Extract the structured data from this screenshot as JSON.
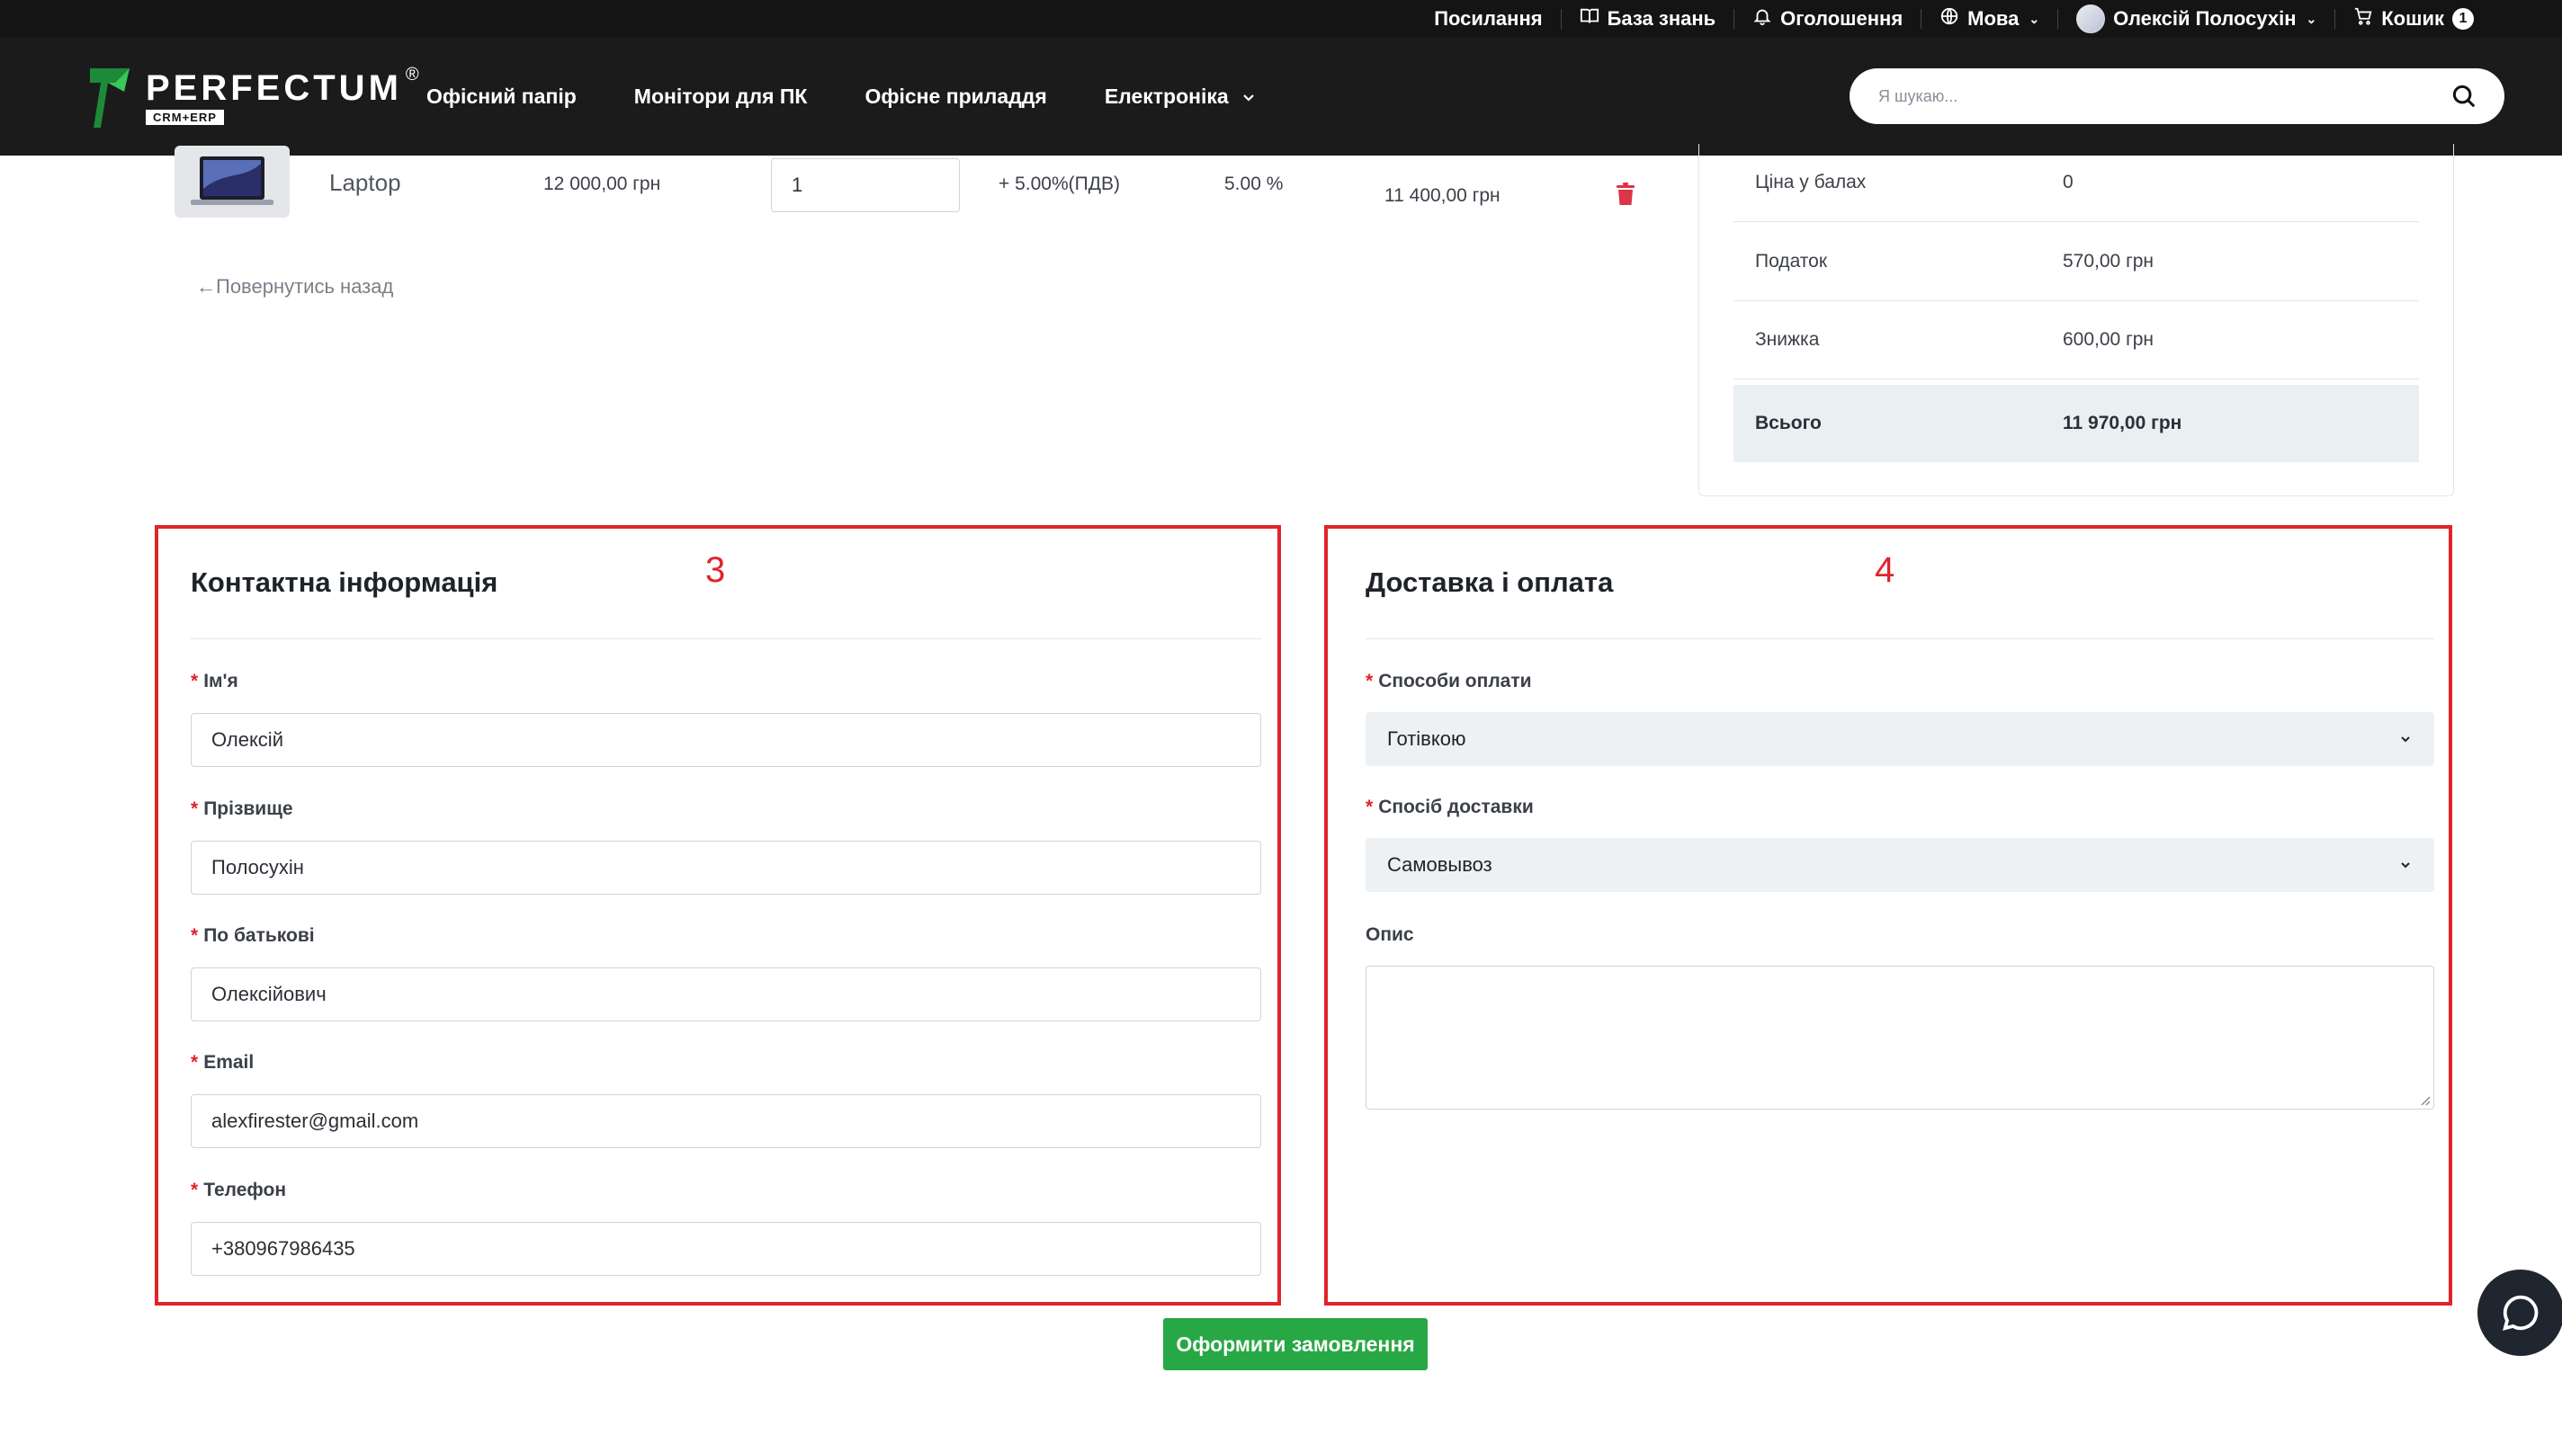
{
  "topbar": {
    "links": "Посилання",
    "knowledge_base": "База знань",
    "announcements": "Оголошення",
    "language": "Мова",
    "user_name": "Олексій Полосухін",
    "cart_label": "Кошик",
    "cart_count": "1"
  },
  "nav": {
    "brand": "PERFECTUM",
    "brand_sub": "CRM+ERP",
    "brand_reg": "®",
    "items": [
      "Офісний папір",
      "Монітори для ПК",
      "Офісне приладдя",
      "Електроніка"
    ],
    "search_placeholder": "Я шукаю..."
  },
  "cart_item": {
    "name": "Laptop",
    "price": "12 000,00 грн",
    "quantity": "1",
    "tax": "+ 5.00%(ПДВ)",
    "discount": "5.00 %",
    "total": "11 400,00 грн"
  },
  "back_link": "Повернутись назад",
  "summary": {
    "rows": [
      {
        "label": "Ціна у балах",
        "value": "0"
      },
      {
        "label": "Податок",
        "value": "570,00 грн"
      },
      {
        "label": "Знижка",
        "value": "600,00 грн"
      },
      {
        "label": "Всього",
        "value": "11 970,00 грн"
      }
    ]
  },
  "contact": {
    "annotation": "3",
    "title": "Контактна інформація",
    "required_mark": "*",
    "fields": [
      {
        "label": "Ім'я",
        "value": "Олексій"
      },
      {
        "label": "Прізвище",
        "value": "Полосухін"
      },
      {
        "label": "По батькові",
        "value": "Олексійович"
      },
      {
        "label": "Email",
        "value": "alexfirester@gmail.com"
      },
      {
        "label": "Телефон",
        "value": "+380967986435"
      }
    ]
  },
  "delivery": {
    "annotation": "4",
    "title": "Доставка і оплата",
    "payment_label": "Способи оплати",
    "payment_value": "Готівкою",
    "shipping_label": "Спосіб доставки",
    "shipping_value": "Самовывоз",
    "description_label": "Опис"
  },
  "submit_label": "Оформити замовлення",
  "colors": {
    "accent_green": "#28a745",
    "annotation_red": "#e0242b",
    "header_bg": "#1b1b1b",
    "delete_red": "#dc3545"
  }
}
